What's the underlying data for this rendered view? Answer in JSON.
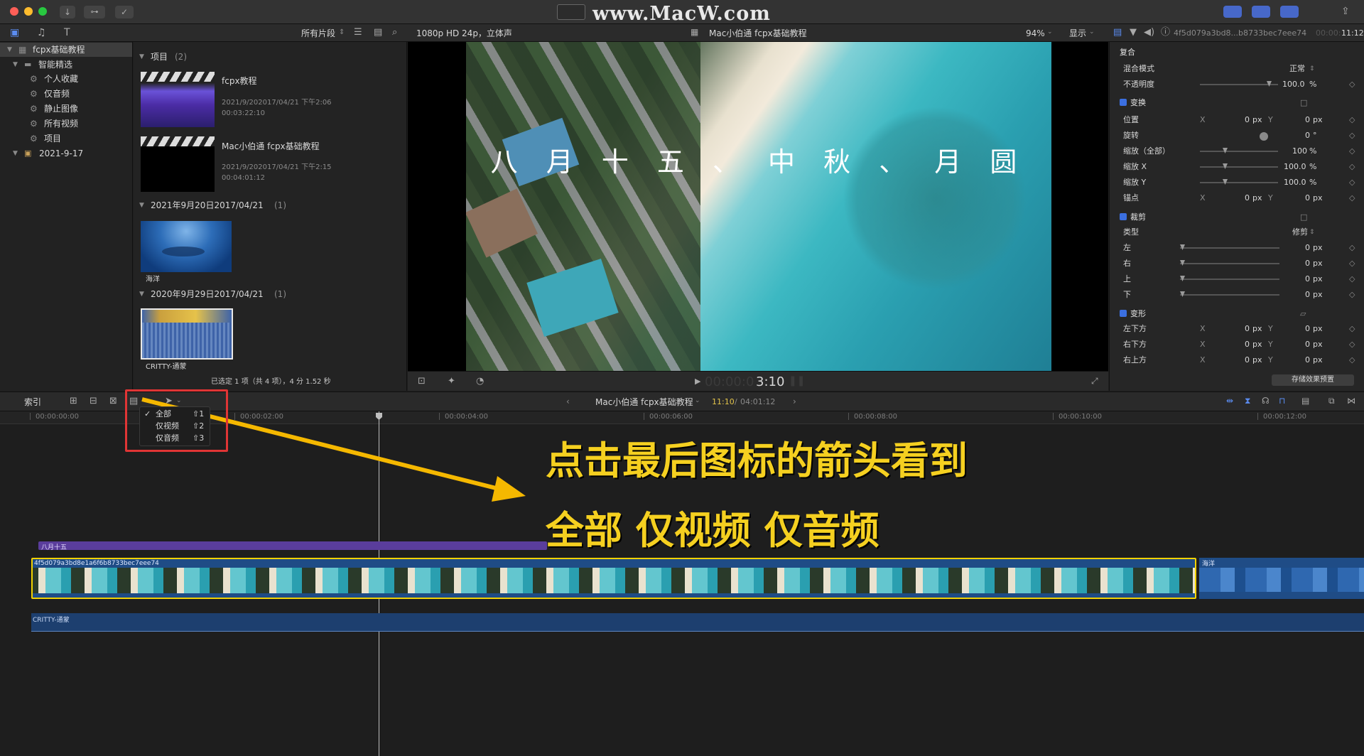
{
  "watermark": "www.MacW.com",
  "toolbar": {
    "browser_filter": "所有片段",
    "viewer_format": "1080p HD 24p，立体声",
    "viewer_title": "Mac小伯通 fcpx基础教程",
    "zoom": "94%",
    "display_menu": "显示",
    "inspector_clip": "4f5d079a3bd8...b8733bec7eee74",
    "inspector_time": "11:12",
    "inspector_time_prefix": "00:00:"
  },
  "library": {
    "items": [
      {
        "label": "fcpx基础教程",
        "level": 0
      },
      {
        "label": "智能精选",
        "level": 1
      },
      {
        "label": "个人收藏",
        "level": 2
      },
      {
        "label": "仅音频",
        "level": 2
      },
      {
        "label": "静止图像",
        "level": 2
      },
      {
        "label": "所有视频",
        "level": 2
      },
      {
        "label": "项目",
        "level": 2
      },
      {
        "label": "2021-9-17",
        "level": 0
      }
    ]
  },
  "browser": {
    "projects_header": "项目",
    "projects_count": "(2)",
    "project1": {
      "name": "fcpx教程",
      "date": "2021/9/202017/04/21 下午2:06",
      "duration": "00:03:22:10"
    },
    "project2": {
      "name": "Mac小伯通 fcpx基础教程",
      "date": "2021/9/202017/04/21 下午2:15",
      "duration": "00:04:01:12"
    },
    "event1": {
      "header": "2021年9月20日2017/04/21",
      "count": "(1)",
      "clip": "海洋"
    },
    "event2": {
      "header": "2020年9月29日2017/04/21",
      "count": "(1)",
      "clip": "CRITTY-通蒙"
    },
    "status": "已选定 1 项（共 4 项），4 分 1.52 秒"
  },
  "viewer": {
    "overlay_text": "八 月 十 五 、 中 秋 、 月 圆",
    "timecode_dim": "00:00:0",
    "timecode": "3:10"
  },
  "inspector": {
    "composite": {
      "title": "复合",
      "blend_label": "混合模式",
      "blend_value": "正常",
      "opacity_label": "不透明度",
      "opacity_value": "100.0",
      "opacity_unit": "%"
    },
    "transform": {
      "title": "变换",
      "rows": [
        {
          "label": "位置",
          "x": "0",
          "y": "0",
          "unit": "px"
        },
        {
          "label": "旋转",
          "value": "0",
          "unit": "°"
        },
        {
          "label": "缩放（全部）",
          "value": "100",
          "unit": "%"
        },
        {
          "label": "缩放 X",
          "value": "100.0",
          "unit": "%"
        },
        {
          "label": "缩放 Y",
          "value": "100.0",
          "unit": "%"
        },
        {
          "label": "锚点",
          "x": "0",
          "y": "0",
          "unit": "px"
        }
      ]
    },
    "crop": {
      "title": "裁剪",
      "type_label": "类型",
      "type_value": "修剪",
      "rows": [
        {
          "label": "左",
          "value": "0",
          "unit": "px"
        },
        {
          "label": "右",
          "value": "0",
          "unit": "px"
        },
        {
          "label": "上",
          "value": "0",
          "unit": "px"
        },
        {
          "label": "下",
          "value": "0",
          "unit": "px"
        }
      ]
    },
    "distort": {
      "title": "变形",
      "rows": [
        {
          "label": "左下方",
          "x": "0",
          "y": "0",
          "unit": "px"
        },
        {
          "label": "右下方",
          "x": "0",
          "y": "0",
          "unit": "px"
        },
        {
          "label": "右上方",
          "x": "0",
          "y": "0",
          "unit": "px"
        }
      ]
    },
    "save_preset": "存储效果预置"
  },
  "timeline": {
    "index_label": "索引",
    "project_name": "Mac小伯通 fcpx基础教程",
    "position": "11:10",
    "duration": "04:01:12",
    "ruler": [
      "00:00:00:00",
      "00:00:02:00",
      "00:00:04:00",
      "00:00:06:00",
      "00:00:08:00",
      "00:00:10:00",
      "00:00:12:00"
    ],
    "title_clip": "八月十五",
    "video_clip": "4f5d079a3bd8e1a6f6b8733bec7eee74",
    "second_clip": "海洋",
    "audio_clip": "CRITTY-通蒙",
    "dropdown": [
      {
        "label": "全部",
        "shortcut": "⇧1",
        "checked": true
      },
      {
        "label": "仅视频",
        "shortcut": "⇧2",
        "checked": false
      },
      {
        "label": "仅音频",
        "shortcut": "⇧3",
        "checked": false
      }
    ]
  },
  "annotation": {
    "line1": "点击最后图标的箭头看到",
    "line2": "全部 仅视频 仅音频"
  },
  "colors": {
    "accent": "#3b6fe0",
    "annotation": "#f5d020",
    "highlight": "#e03535",
    "title_clip": "#5a3d9c",
    "selection": "#f2d200"
  }
}
